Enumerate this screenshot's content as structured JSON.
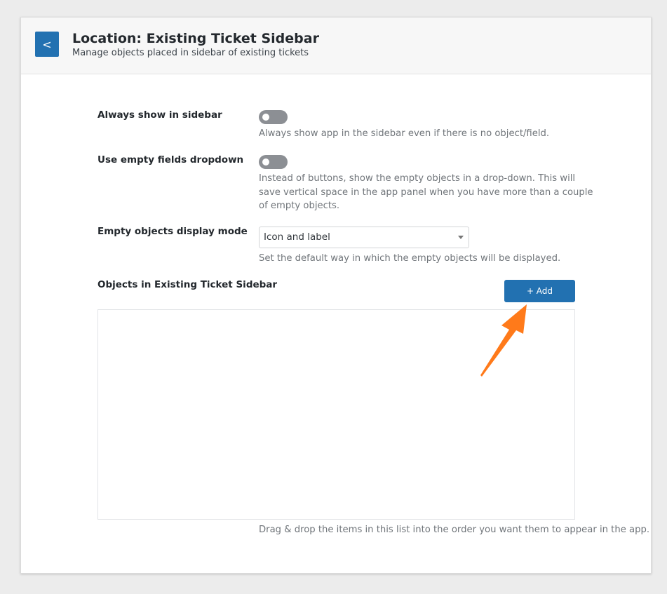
{
  "header": {
    "back_label": "<",
    "title": "Location: Existing Ticket Sidebar",
    "subtitle": "Manage objects placed in sidebar of existing tickets"
  },
  "settings": {
    "always_show": {
      "label": "Always show in sidebar",
      "enabled": false,
      "description": "Always show app in the sidebar even if there is no object/field."
    },
    "empty_dropdown": {
      "label": "Use empty fields dropdown",
      "enabled": false,
      "description_lines": [
        "Instead of buttons, show the empty objects in a drop-down. This will",
        "save vertical space in the app panel when you have more than a couple",
        "of empty objects."
      ]
    },
    "display_mode": {
      "label": "Empty objects display mode",
      "selected": "Icon and label",
      "description": "Set the default way in which the empty objects will be displayed."
    }
  },
  "objects": {
    "label": "Objects in Existing Ticket Sidebar",
    "add_label": "+ Add",
    "items": [],
    "help": "Drag & drop the items in this list into the order you want them to appear in the app."
  },
  "colors": {
    "accent": "#2271b1",
    "annotation_arrow": "#ff7a1a",
    "toggle_off": "#8c8f94"
  }
}
